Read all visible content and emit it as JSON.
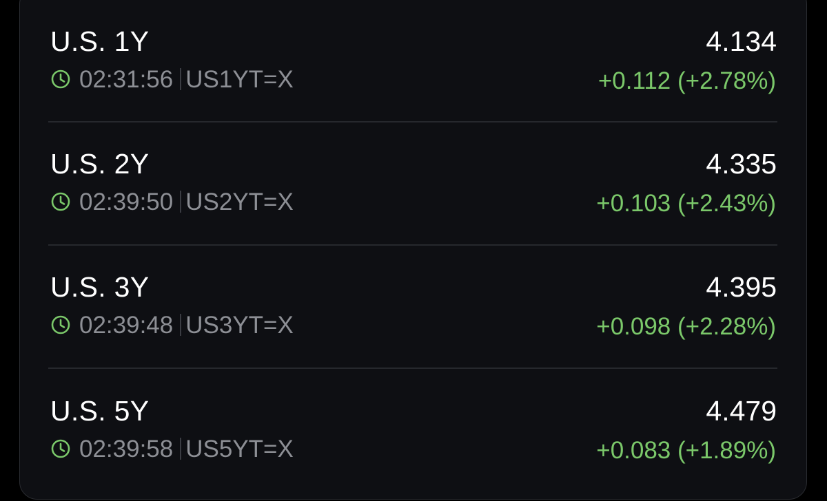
{
  "colors": {
    "background": "#000000",
    "card": "#0e0f13",
    "primary_text": "#ffffff",
    "secondary_text": "#8d8f95",
    "positive": "#7bc86a",
    "divider": "#26282d"
  },
  "quotes": [
    {
      "name": "U.S. 1Y",
      "time": "02:31:56",
      "symbol": "US1YT=X",
      "price": "4.134",
      "change": "+0.112 (+2.78%)"
    },
    {
      "name": "U.S. 2Y",
      "time": "02:39:50",
      "symbol": "US2YT=X",
      "price": "4.335",
      "change": "+0.103 (+2.43%)"
    },
    {
      "name": "U.S. 3Y",
      "time": "02:39:48",
      "symbol": "US3YT=X",
      "price": "4.395",
      "change": "+0.098 (+2.28%)"
    },
    {
      "name": "U.S. 5Y",
      "time": "02:39:58",
      "symbol": "US5YT=X",
      "price": "4.479",
      "change": "+0.083 (+1.89%)"
    }
  ]
}
